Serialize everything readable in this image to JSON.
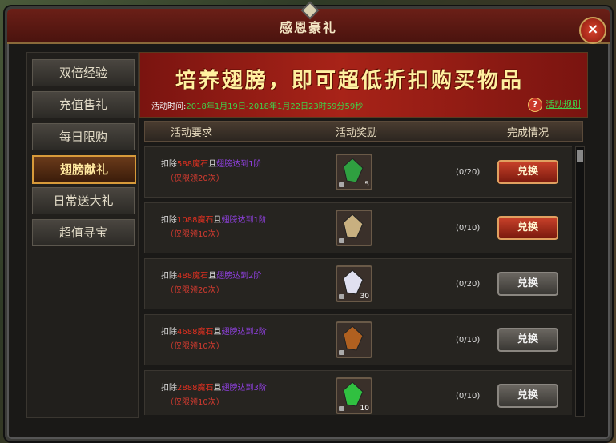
{
  "window": {
    "title": "感恩豪礼",
    "close_icon": "×"
  },
  "sidebar": {
    "items": [
      {
        "label": "双倍经验",
        "active": false
      },
      {
        "label": "充值售礼",
        "active": false
      },
      {
        "label": "每日限购",
        "active": false
      },
      {
        "label": "翅膀献礼",
        "active": true
      },
      {
        "label": "日常送大礼",
        "active": false
      },
      {
        "label": "超值寻宝",
        "active": false
      }
    ]
  },
  "banner": {
    "headline": "培养翅膀，即可超低折扣购买物品",
    "time_label": "活动时间:",
    "time_value": "2018年1月19日-2018年1月22日23时59分59秒",
    "rules_link": "活动规则",
    "rules_icon": "?"
  },
  "columns": {
    "requirement": "活动要求",
    "reward": "活动奖励",
    "status": "完成情况"
  },
  "rows": [
    {
      "deduct": "扣除",
      "amount": "588",
      "currency": "魔石",
      "and": "且",
      "condition": "翅膀达到1阶",
      "limit": "（仅限领20次）",
      "item_icon": "green-gem",
      "item_count": "5",
      "progress": "(0/20)",
      "button": "兑换",
      "enabled": true,
      "color": "#2fa040"
    },
    {
      "deduct": "扣除",
      "amount": "1088",
      "currency": "魔石",
      "and": "且",
      "condition": "翅膀达到1阶",
      "limit": "（仅限领10次）",
      "item_icon": "scroll-paper",
      "item_count": "",
      "progress": "(0/10)",
      "button": "兑换",
      "enabled": true,
      "color": "#c8b080"
    },
    {
      "deduct": "扣除",
      "amount": "488",
      "currency": "魔石",
      "and": "且",
      "condition": "翅膀达到2阶",
      "limit": "（仅限领20次）",
      "item_icon": "white-feather",
      "item_count": "30",
      "progress": "(0/20)",
      "button": "兑换",
      "enabled": false,
      "color": "#e0e0f0"
    },
    {
      "deduct": "扣除",
      "amount": "4688",
      "currency": "魔石",
      "and": "且",
      "condition": "翅膀达到2阶",
      "limit": "（仅限领10次）",
      "item_icon": "bronze-ring",
      "item_count": "",
      "progress": "(0/10)",
      "button": "兑换",
      "enabled": false,
      "color": "#b06020"
    },
    {
      "deduct": "扣除",
      "amount": "2888",
      "currency": "魔石",
      "and": "且",
      "condition": "翅膀达到3阶",
      "limit": "（仅限领10次）",
      "item_icon": "green-gem",
      "item_count": "10",
      "progress": "(0/10)",
      "button": "兑换",
      "enabled": false,
      "color": "#30c040"
    }
  ]
}
